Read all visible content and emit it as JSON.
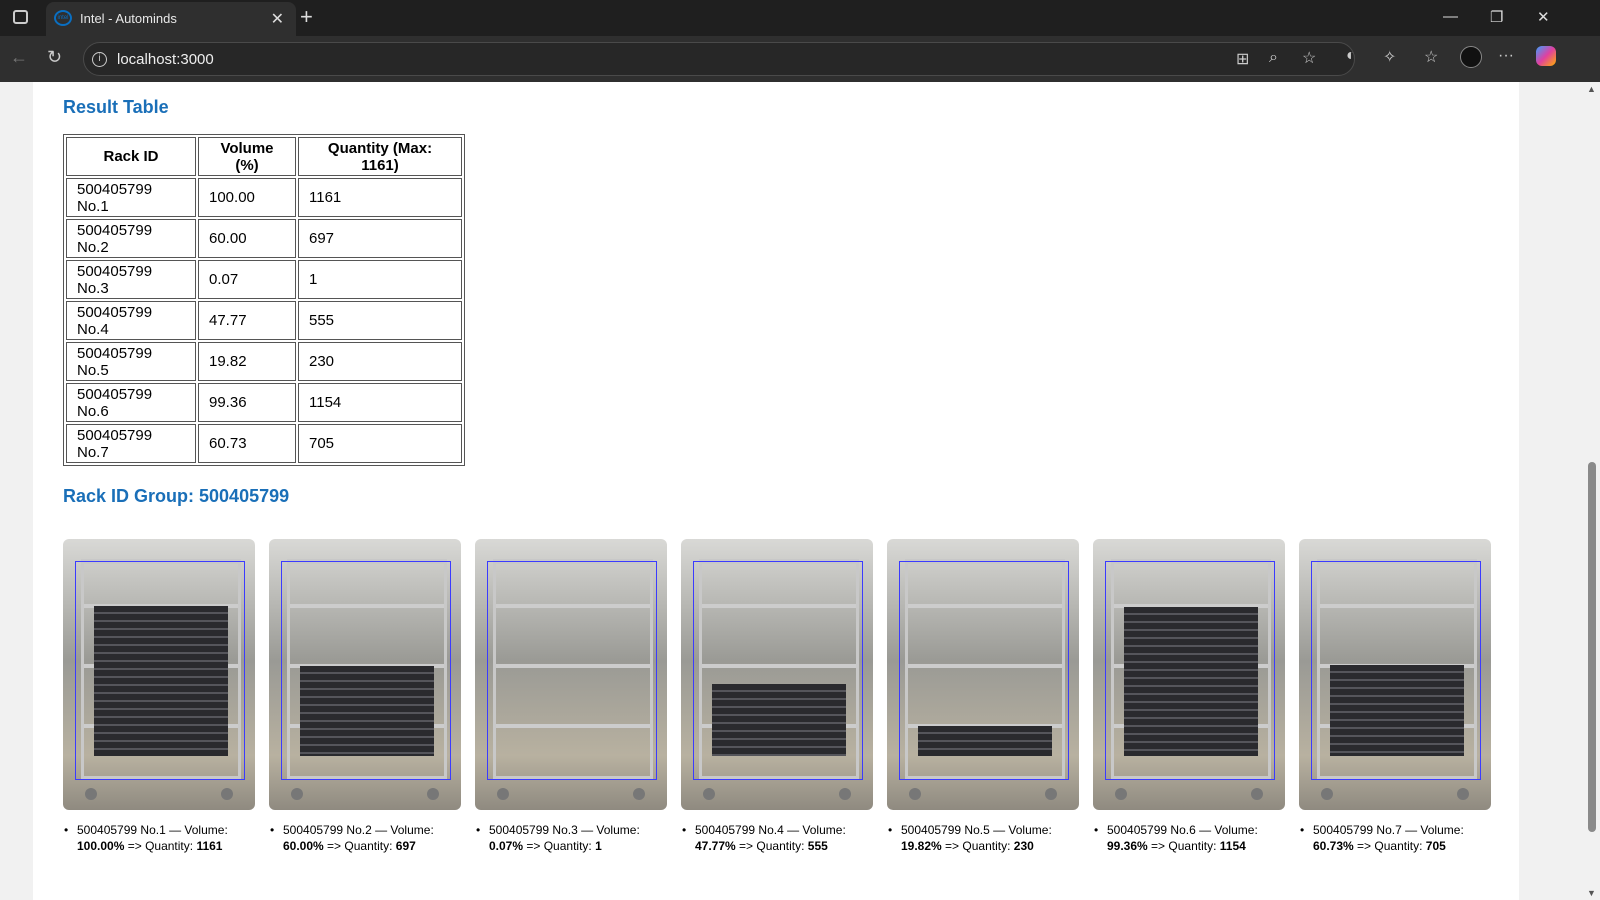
{
  "browser": {
    "tab_title": "Intel - Autominds",
    "url": "localhost:3000"
  },
  "result_heading": "Result Table",
  "table": {
    "headers": [
      "Rack ID",
      "Volume (%)",
      "Quantity (Max: 1161)"
    ],
    "rows": [
      [
        "500405799 No.1",
        "100.00",
        "1161"
      ],
      [
        "500405799 No.2",
        "60.00",
        "697"
      ],
      [
        "500405799 No.3",
        "0.07",
        "1"
      ],
      [
        "500405799 No.4",
        "47.77",
        "555"
      ],
      [
        "500405799 No.5",
        "19.82",
        "230"
      ],
      [
        "500405799 No.6",
        "99.36",
        "1154"
      ],
      [
        "500405799 No.7",
        "60.73",
        "705"
      ]
    ]
  },
  "group_heading": "Rack ID Group: 500405799",
  "cards": [
    {
      "label": "500405799 No.1 — Volume:",
      "volume": "100.00%",
      "qty_label": "=> Quantity:",
      "qty": "1161",
      "fill": 100
    },
    {
      "label": "500405799 No.2 — Volume:",
      "volume": "60.00%",
      "qty_label": "=> Quantity:",
      "qty": "697",
      "fill": 60
    },
    {
      "label": "500405799 No.3 — Volume:",
      "volume": "0.07%",
      "qty_label": "=> Quantity:",
      "qty": "1",
      "fill": 0.07
    },
    {
      "label": "500405799 No.4 — Volume:",
      "volume": "47.77%",
      "qty_label": "=> Quantity:",
      "qty": "555",
      "fill": 47.77
    },
    {
      "label": "500405799 No.5 — Volume:",
      "volume": "19.82%",
      "qty_label": "=> Quantity:",
      "qty": "230",
      "fill": 19.82
    },
    {
      "label": "500405799 No.6 — Volume:",
      "volume": "99.36%",
      "qty_label": "=> Quantity:",
      "qty": "1154",
      "fill": 99.36
    },
    {
      "label": "500405799 No.7 — Volume:",
      "volume": "60.73%",
      "qty_label": "=> Quantity:",
      "qty": "705",
      "fill": 60.73
    }
  ]
}
